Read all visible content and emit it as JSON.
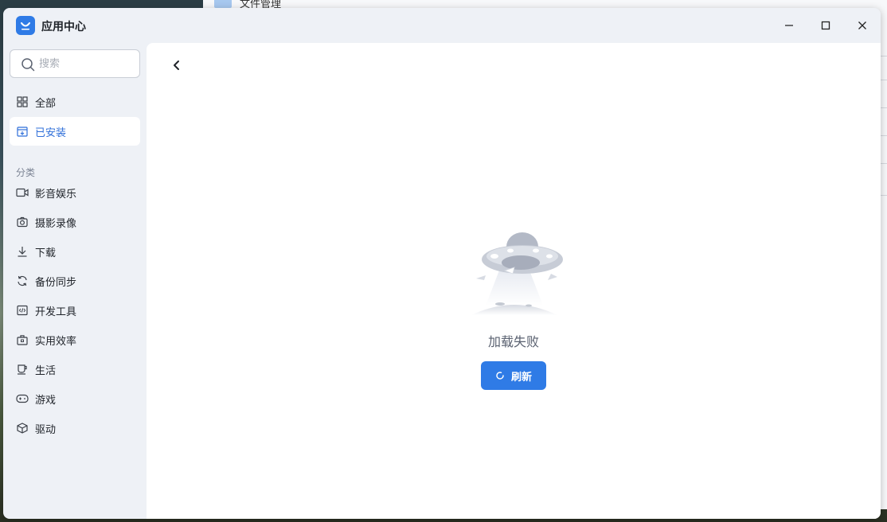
{
  "background_window": {
    "title": "文件管理"
  },
  "window": {
    "title": "应用中心"
  },
  "search": {
    "placeholder": "搜索"
  },
  "nav": [
    {
      "label": "全部",
      "icon": "grid-icon"
    },
    {
      "label": "已安装",
      "icon": "installed-box-icon",
      "active": true
    }
  ],
  "categories": {
    "heading": "分类",
    "items": [
      {
        "label": "影音娱乐",
        "icon": "video-icon"
      },
      {
        "label": "摄影录像",
        "icon": "camera-icon"
      },
      {
        "label": "下载",
        "icon": "download-icon"
      },
      {
        "label": "备份同步",
        "icon": "sync-icon"
      },
      {
        "label": "开发工具",
        "icon": "code-icon"
      },
      {
        "label": "实用效率",
        "icon": "toolbox-icon"
      },
      {
        "label": "生活",
        "icon": "cup-icon"
      },
      {
        "label": "游戏",
        "icon": "gamepad-icon"
      },
      {
        "label": "驱动",
        "icon": "cube-icon"
      }
    ]
  },
  "main": {
    "status": "加载失败",
    "refresh_label": "刷新"
  },
  "colors": {
    "accent": "#2f7be6",
    "sidebar_bg": "#eef1f6",
    "active_text": "#2f6fd9"
  }
}
